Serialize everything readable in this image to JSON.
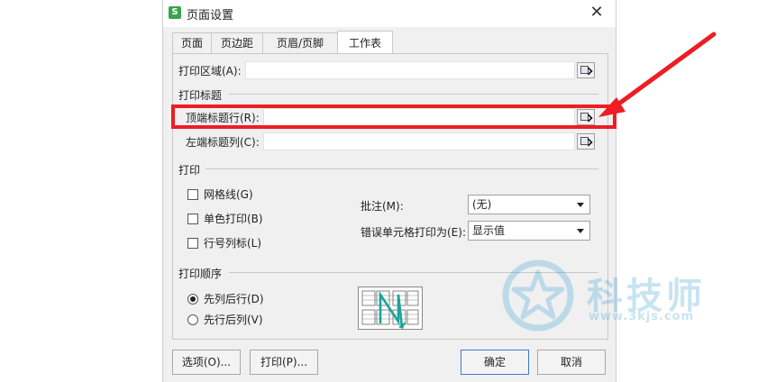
{
  "window": {
    "title": "页面设置",
    "app_icon_glyph": "S",
    "close_glyph": "✕"
  },
  "tabs": [
    {
      "label": "页面",
      "active": false
    },
    {
      "label": "页边距",
      "active": false
    },
    {
      "label": "页眉/页脚",
      "active": false
    },
    {
      "label": "工作表",
      "active": true
    }
  ],
  "print_area": {
    "label": "打印区域(A):",
    "value": ""
  },
  "print_titles": {
    "section": "打印标题",
    "top_rows_label": "顶端标题行(R):",
    "top_rows_value": "",
    "left_cols_label": "左端标题列(C):",
    "left_cols_value": ""
  },
  "print": {
    "section": "打印",
    "gridlines": {
      "label": "网格线(G)",
      "checked": false
    },
    "black_white": {
      "label": "单色打印(B)",
      "checked": false
    },
    "row_col_headers": {
      "label": "行号列标(L)",
      "checked": false
    },
    "comments_label": "批注(M):",
    "comments_value": "(无)",
    "cell_errors_label": "错误单元格打印为(E):",
    "cell_errors_value": "显示值"
  },
  "page_order": {
    "section": "打印顺序",
    "down_then_over": {
      "label": "先列后行(D)",
      "selected": true
    },
    "over_then_down": {
      "label": "先行后列(V)",
      "selected": false
    }
  },
  "buttons": {
    "options": "选项(O)...",
    "print": "打印(P)...",
    "ok": "确定",
    "cancel": "取消"
  },
  "watermark": {
    "text": "科技师",
    "url": "www.3kjs.com"
  },
  "colors": {
    "annotation": "#ee1c24",
    "watermark": "#3a9fd4",
    "app_icon": "#3aa54a",
    "order_arrow": "#1aa39a"
  }
}
